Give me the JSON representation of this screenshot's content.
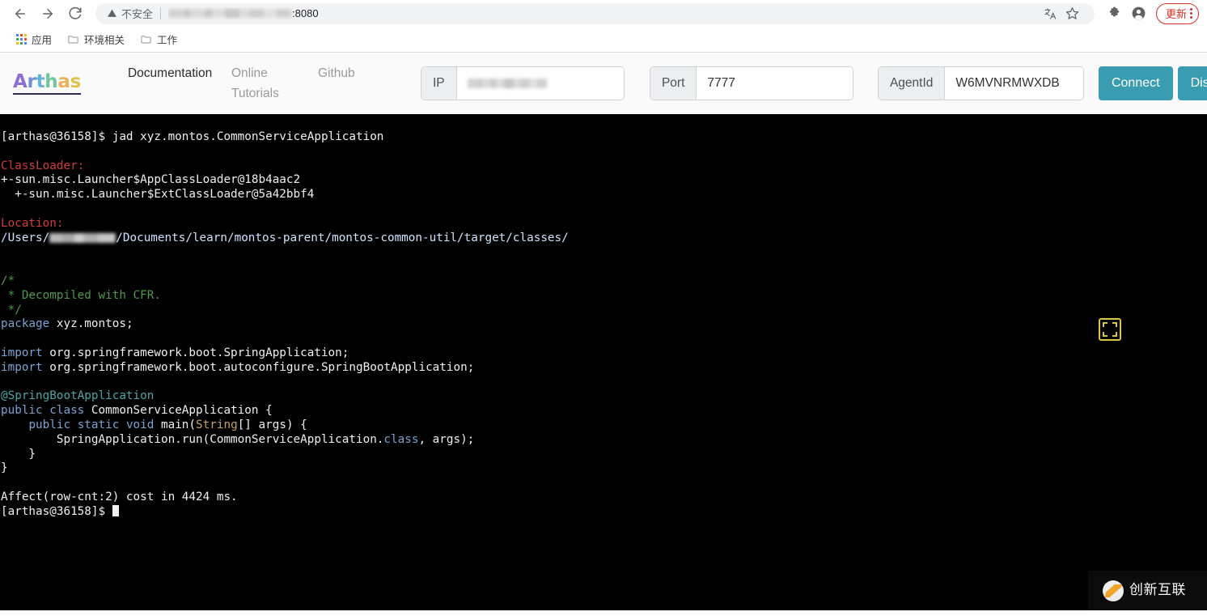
{
  "browser": {
    "back_label": "Back",
    "forward_label": "Forward",
    "reload_label": "Reload",
    "security_text": "不安全",
    "url_suffix": ":8080",
    "url_redacted": true,
    "translate_icon": "translate-icon",
    "bookmark_icon": "star-icon",
    "extensions_icon": "puzzle-icon",
    "profile_icon": "avatar-icon",
    "update_label": "更新",
    "menu_icon": "kebab-menu-icon",
    "bookmarks": [
      {
        "label": "应用",
        "icon": "apps-grid-icon"
      },
      {
        "label": "环境相关",
        "icon": "folder-icon"
      },
      {
        "label": "工作",
        "icon": "folder-icon"
      }
    ]
  },
  "app_header": {
    "logo": {
      "letters": [
        {
          "char": "A",
          "color": "#8b6fd6"
        },
        {
          "char": "r",
          "color": "#6f8fd6"
        },
        {
          "char": "t",
          "color": "#62b3d6"
        },
        {
          "char": "h",
          "color": "#6fc79a"
        },
        {
          "char": "a",
          "color": "#e9b15c"
        },
        {
          "char": "s",
          "color": "#e0c24e"
        }
      ],
      "underline_color": "#2c2c54"
    },
    "nav": [
      {
        "label": "Documentation",
        "active": true
      },
      {
        "label": "Online Tutorials",
        "active": false
      },
      {
        "label": "Github",
        "active": false
      }
    ],
    "fields": [
      {
        "label": "IP",
        "value": "",
        "redacted": true
      },
      {
        "label": "Port",
        "value": "7777",
        "redacted": false
      },
      {
        "label": "AgentId",
        "value": "W6MVNRMWXDB",
        "redacted": false
      }
    ],
    "buttons": [
      {
        "label": "Connect",
        "color": "#3a9cb0"
      },
      {
        "label": "Disconnect",
        "color": "#3a9cb0"
      }
    ]
  },
  "terminal": {
    "fullscreen_icon": "fullscreen-expand-icon",
    "prompt": "[arthas@36158]$ ",
    "lines": [
      {
        "id": "l1",
        "segments": [
          {
            "t": "[arthas@36158]$ jad xyz.montos.CommonServiceApplication",
            "c": "c-white"
          }
        ]
      },
      {
        "id": "l2",
        "segments": [
          {
            "t": " ",
            "c": "c-white"
          }
        ]
      },
      {
        "id": "l3",
        "segments": [
          {
            "t": "ClassLoader:",
            "c": "c-red"
          }
        ]
      },
      {
        "id": "l4",
        "segments": [
          {
            "t": "+-sun.misc.Launcher$AppClassLoader@18b4aac2",
            "c": "c-white"
          }
        ]
      },
      {
        "id": "l5",
        "segments": [
          {
            "t": "  +-sun.misc.Launcher$ExtClassLoader@5a42bbf4",
            "c": "c-white"
          }
        ]
      },
      {
        "id": "l6",
        "segments": [
          {
            "t": " ",
            "c": "c-white"
          }
        ]
      },
      {
        "id": "l7",
        "segments": [
          {
            "t": "Location:",
            "c": "c-red"
          }
        ]
      },
      {
        "id": "l8",
        "segments": [
          {
            "t": "/Users/",
            "c": "c-cyan"
          },
          {
            "t": "REDACTED",
            "c": "redact"
          },
          {
            "t": "/Documents/learn/montos-parent/montos-common-util/target/classes/",
            "c": "c-cyan"
          }
        ]
      },
      {
        "id": "l9",
        "segments": [
          {
            "t": " ",
            "c": "c-white"
          }
        ]
      },
      {
        "id": "l10",
        "segments": [
          {
            "t": " ",
            "c": "c-white"
          }
        ]
      },
      {
        "id": "l11",
        "segments": [
          {
            "t": "/*",
            "c": "c-green"
          }
        ]
      },
      {
        "id": "l12",
        "segments": [
          {
            "t": " * Decompiled with CFR.",
            "c": "c-green"
          }
        ]
      },
      {
        "id": "l13",
        "segments": [
          {
            "t": " */",
            "c": "c-green"
          }
        ]
      },
      {
        "id": "l14",
        "segments": [
          {
            "t": "package",
            "c": "c-blue"
          },
          {
            "t": " xyz.montos;",
            "c": "c-white"
          }
        ]
      },
      {
        "id": "l15",
        "segments": [
          {
            "t": " ",
            "c": "c-white"
          }
        ]
      },
      {
        "id": "l16",
        "segments": [
          {
            "t": "import",
            "c": "c-blue"
          },
          {
            "t": " org.springframework.boot.SpringApplication;",
            "c": "c-white"
          }
        ]
      },
      {
        "id": "l17",
        "segments": [
          {
            "t": "import",
            "c": "c-blue"
          },
          {
            "t": " org.springframework.boot.autoconfigure.SpringBootApplication;",
            "c": "c-white"
          }
        ]
      },
      {
        "id": "l18",
        "segments": [
          {
            "t": " ",
            "c": "c-white"
          }
        ]
      },
      {
        "id": "l19",
        "segments": [
          {
            "t": "@SpringBootApplication",
            "c": "c-teal"
          }
        ]
      },
      {
        "id": "l20",
        "segments": [
          {
            "t": "public class",
            "c": "c-blue"
          },
          {
            "t": " CommonServiceApplication {",
            "c": "c-white"
          }
        ]
      },
      {
        "id": "l21",
        "segments": [
          {
            "t": "    ",
            "c": "c-white"
          },
          {
            "t": "public static void",
            "c": "c-blue"
          },
          {
            "t": " main(",
            "c": "c-white"
          },
          {
            "t": "String",
            "c": "c-orange"
          },
          {
            "t": "[] args) {",
            "c": "c-white"
          }
        ]
      },
      {
        "id": "l22",
        "segments": [
          {
            "t": "        SpringApplication.run(CommonServiceApplication.",
            "c": "c-white"
          },
          {
            "t": "class",
            "c": "c-blue"
          },
          {
            "t": ", args);",
            "c": "c-white"
          }
        ]
      },
      {
        "id": "l23",
        "segments": [
          {
            "t": "    }",
            "c": "c-white"
          }
        ]
      },
      {
        "id": "l24",
        "segments": [
          {
            "t": "}",
            "c": "c-white"
          }
        ]
      },
      {
        "id": "l25",
        "segments": [
          {
            "t": " ",
            "c": "c-white"
          }
        ]
      },
      {
        "id": "l26",
        "segments": [
          {
            "t": "Affect(row-cnt:2) cost in 4424 ms.",
            "c": "c-white"
          }
        ]
      },
      {
        "id": "l27",
        "segments": [
          {
            "t": "[arthas@36158]$ ",
            "c": "c-white"
          },
          {
            "t": "CURSOR",
            "c": "cursor"
          }
        ]
      }
    ]
  },
  "watermark": {
    "text": "创新互联",
    "logo_icon": "swoosh-circle-logo"
  }
}
